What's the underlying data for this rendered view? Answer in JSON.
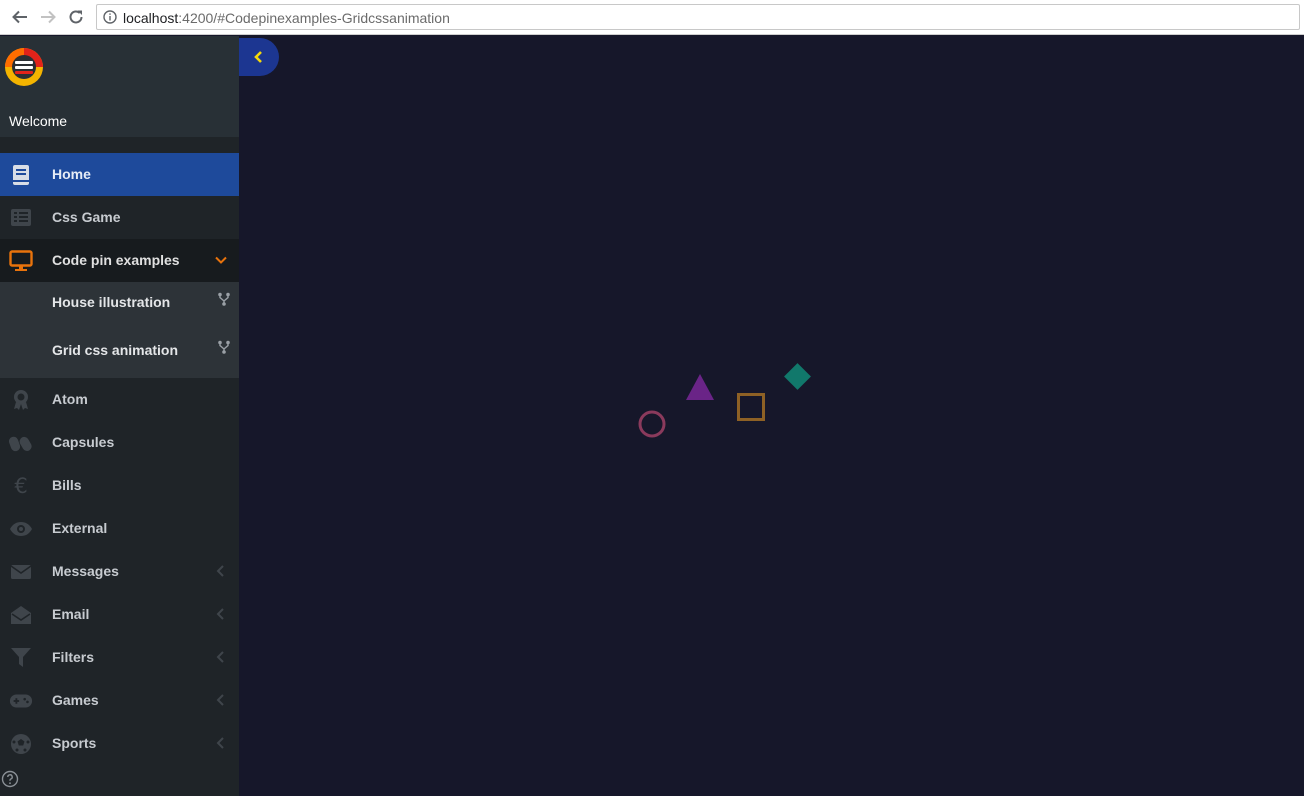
{
  "browser": {
    "url_host": "localhost",
    "url_rest": ":4200/#Codepinexamples-Gridcssanimation"
  },
  "sidebar": {
    "welcome": "Welcome",
    "items": [
      {
        "label": "Home",
        "icon": "book-icon"
      },
      {
        "label": "Css Game",
        "icon": "list-icon"
      },
      {
        "label": "Code pin examples",
        "icon": "monitor-icon",
        "expanded": true
      },
      {
        "label": "Atom",
        "icon": "award-icon"
      },
      {
        "label": "Capsules",
        "icon": "capsules-icon"
      },
      {
        "label": "Bills",
        "icon": "euro-icon"
      },
      {
        "label": "External",
        "icon": "eye-icon"
      },
      {
        "label": "Messages",
        "icon": "envelope-icon"
      },
      {
        "label": "Email",
        "icon": "envelope-open-icon"
      },
      {
        "label": "Filters",
        "icon": "filter-icon"
      },
      {
        "label": "Games",
        "icon": "gamepad-icon"
      },
      {
        "label": "Sports",
        "icon": "soccer-ball-icon"
      }
    ],
    "submenu": [
      {
        "label": "House illustration"
      },
      {
        "label": "Grid css animation"
      }
    ]
  },
  "colors": {
    "accent": "#1e4a9b",
    "toggle": "#1c3691",
    "toggle_arrow": "#f5d90a",
    "circle": "#8a3a5c",
    "triangle": "#6a2487",
    "square": "#8e6125",
    "diamond": "#11786b",
    "code_icon": "#e8730c"
  }
}
